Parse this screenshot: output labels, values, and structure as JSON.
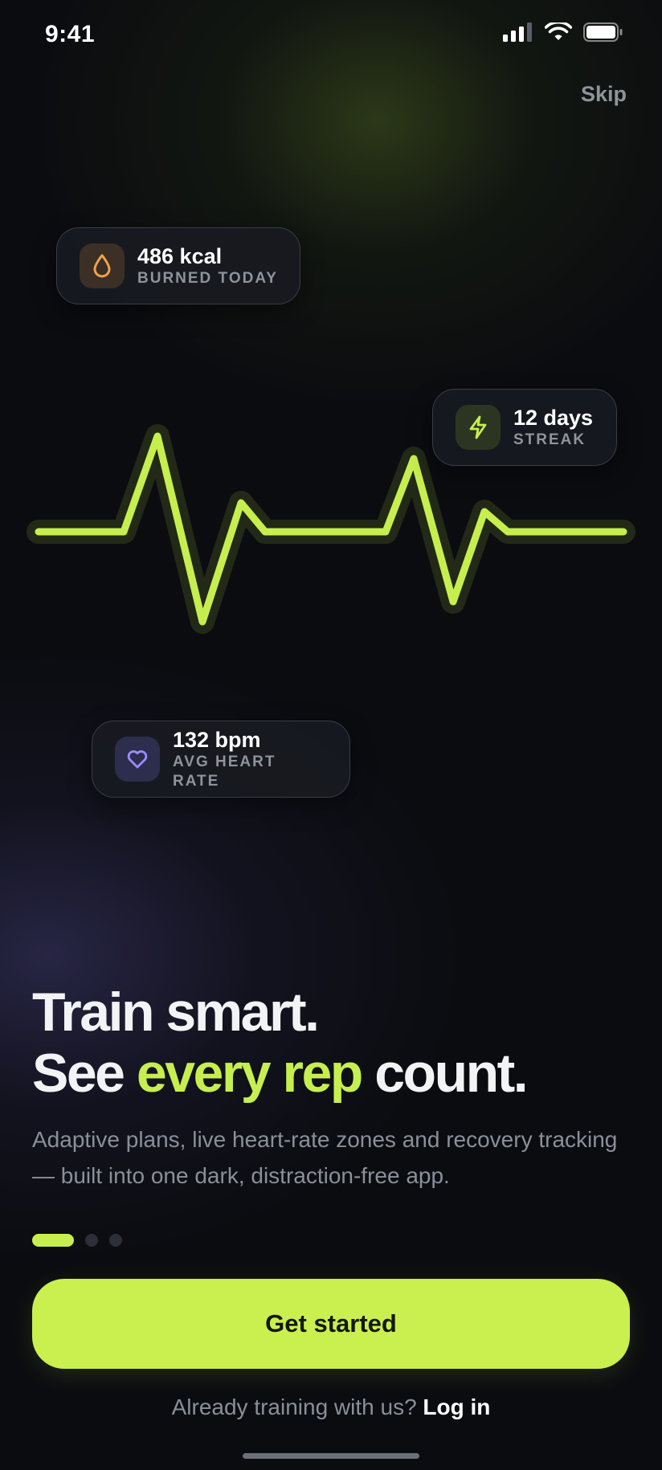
{
  "status_bar": {
    "time": "9:41",
    "icons": [
      "cellular-signal-icon",
      "wifi-icon",
      "battery-icon"
    ]
  },
  "header": {
    "skip_label": "Skip"
  },
  "stat_cards": {
    "kcal": {
      "value": "486 kcal",
      "label": "BURNED TODAY",
      "icon": "flame-drop-icon",
      "icon_color": "#f0a24a"
    },
    "streak": {
      "value": "12 days",
      "label": "STREAK",
      "icon": "lightning-bolt-icon",
      "icon_color": "#c6ef4e"
    },
    "bpm": {
      "value": "132 bpm",
      "label": "AVG HEART RATE",
      "icon": "heart-icon",
      "icon_color": "#9a8cff"
    }
  },
  "headline": {
    "line1": "Train smart.",
    "line2_before": "See ",
    "line2_accent": "every rep",
    "line2_after": " count."
  },
  "subtext": "Adaptive plans, live heart-rate zones and recovery tracking — built into one dark, distraction-free app.",
  "pagination": {
    "total": 3,
    "current": 1
  },
  "cta": {
    "label": "Get started"
  },
  "login": {
    "prompt": "Already training with us?",
    "link_label": "Log in"
  },
  "colors": {
    "accent": "#c9f04e",
    "background": "#0b0c10",
    "muted_text": "#8a8f99"
  }
}
